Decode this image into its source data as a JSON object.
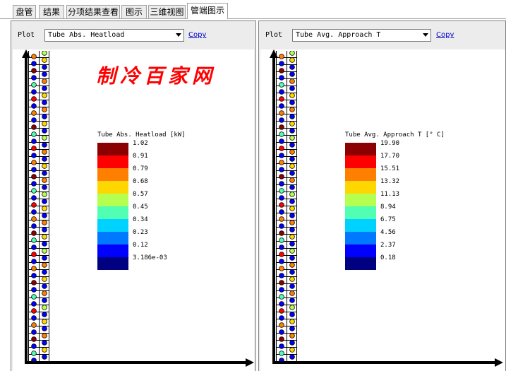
{
  "tabs": [
    {
      "label": "盘管",
      "active": false
    },
    {
      "label": "结果",
      "active": false
    },
    {
      "label": "分项结果查看",
      "active": false
    },
    {
      "label": "图示",
      "active": false
    },
    {
      "label": "三维视图",
      "active": false
    },
    {
      "label": "管端图示",
      "active": true
    }
  ],
  "panels": [
    {
      "plot_label": "Plot",
      "selected": "Tube Abs. Heatload",
      "copy_label": "Copy",
      "legend": {
        "title": "Tube Abs. Heatload [kW]",
        "values": [
          "1.02",
          "0.91",
          "0.79",
          "0.68",
          "0.57",
          "0.45",
          "0.34",
          "0.23",
          "0.12",
          "3.186e-03"
        ]
      },
      "watermark": "制冷百家网"
    },
    {
      "plot_label": "Plot",
      "selected": "Tube Avg. Approach T",
      "copy_label": "Copy",
      "legend": {
        "title": "Tube Avg. Approach T [° C]",
        "values": [
          "19.90",
          "17.70",
          "15.51",
          "13.32",
          "11.13",
          "8.94",
          "6.75",
          "4.56",
          "2.37",
          "0.18"
        ]
      }
    }
  ],
  "scale_colors": [
    "#8b0000",
    "#ff0000",
    "#ff7f00",
    "#ffd700",
    "#b4ff50",
    "#50ffb4",
    "#00d2ff",
    "#0078ff",
    "#0000ff",
    "#000080"
  ],
  "tube_colors": {
    "left": [
      "#ff7f00",
      "#0000ff",
      "#8b0000",
      "#0000ff",
      "#50ffb4",
      "#0000ff",
      "#ff0000",
      "#0000ff",
      "#ff7f00",
      "#0000ff",
      "#8b0000",
      "#50ffb4",
      "#0000ff",
      "#ff0000",
      "#0000ff",
      "#ff7f00",
      "#0000ff",
      "#8b0000",
      "#0000ff",
      "#50ffb4",
      "#0000ff",
      "#ff0000",
      "#0000ff",
      "#ff7f00",
      "#0000ff",
      "#8b0000",
      "#50ffb4",
      "#0000ff",
      "#ff0000",
      "#0000ff",
      "#ff7f00",
      "#0000ff",
      "#8b0000",
      "#0000ff",
      "#50ffb4",
      "#0000ff",
      "#ff0000",
      "#0000ff",
      "#ff7f00",
      "#0000ff",
      "#8b0000",
      "#0000ff",
      "#50ffb4",
      "#0000ff"
    ],
    "right": [
      "#b4ff50",
      "#ffd700",
      "#0000ff",
      "#0000ff",
      "#ff7f00",
      "#0000ff",
      "#ffd700",
      "#0000ff",
      "#ff7f00",
      "#0000ff",
      "#ffd700",
      "#0000ff",
      "#b4ff50",
      "#0000ff",
      "#ff7f00",
      "#0000ff",
      "#ffd700",
      "#0000ff",
      "#ff7f00",
      "#0000ff",
      "#b4ff50",
      "#0000ff",
      "#ffd700",
      "#0000ff",
      "#ff7f00",
      "#0000ff",
      "#ffd700",
      "#0000ff",
      "#b4ff50",
      "#0000ff",
      "#ff7f00",
      "#0000ff",
      "#ffd700",
      "#0000ff",
      "#ff7f00",
      "#0000ff",
      "#b4ff50",
      "#0000ff",
      "#ffd700",
      "#0000ff",
      "#ff7f00",
      "#0000ff",
      "#ffd700",
      "#0000ff"
    ]
  }
}
